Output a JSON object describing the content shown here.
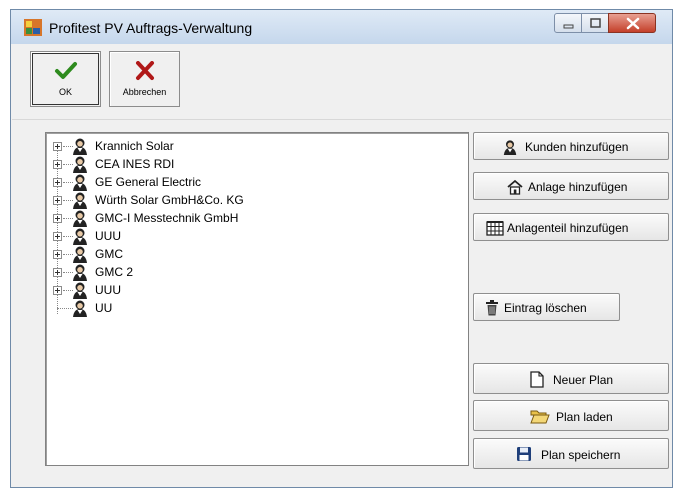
{
  "window": {
    "title": "Profitest PV Auftrags-Verwaltung"
  },
  "toolbar": {
    "ok_label": "OK",
    "cancel_label": "Abbrechen"
  },
  "tree": {
    "items": [
      {
        "label": "Krannich Solar",
        "expandable": true
      },
      {
        "label": "CEA INES RDI",
        "expandable": true
      },
      {
        "label": "GE General Electric",
        "expandable": true
      },
      {
        "label": "Würth Solar GmbH&Co. KG",
        "expandable": true
      },
      {
        "label": "GMC-I Messtechnik GmbH",
        "expandable": true
      },
      {
        "label": "UUU",
        "expandable": true
      },
      {
        "label": "GMC",
        "expandable": true
      },
      {
        "label": "GMC 2",
        "expandable": true
      },
      {
        "label": "UUU",
        "expandable": true
      },
      {
        "label": "UU",
        "expandable": false
      }
    ]
  },
  "actions": {
    "add_customer": "Kunden hinzufügen",
    "add_plant": "Anlage hinzufügen",
    "add_plant_part": "Anlagenteil hinzufügen",
    "delete_entry": "Eintrag löschen",
    "new_plan": "Neuer Plan",
    "load_plan": "Plan laden",
    "save_plan": "Plan speichern"
  },
  "icons": {
    "ok": "checkmark-icon",
    "cancel": "red-x-icon",
    "customer": "person-icon",
    "plant": "house-icon",
    "plant_part": "grid-panel-icon",
    "delete": "trash-icon",
    "new_plan": "blank-document-icon",
    "load_plan": "open-folder-icon",
    "save_plan": "floppy-disk-icon"
  },
  "colors": {
    "ok_check": "#2e8b1e",
    "cancel_x": "#b01818",
    "close_button": "#c4402a"
  }
}
